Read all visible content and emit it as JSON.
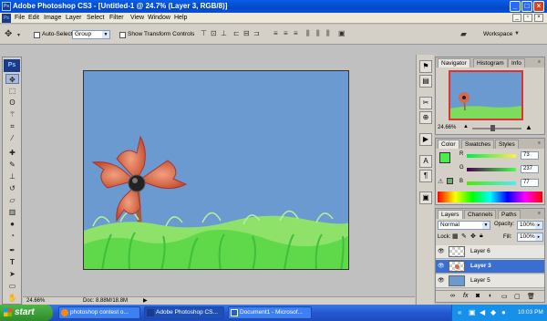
{
  "window": {
    "title": "Adobe Photoshop CS3 - [Untitled-1 @ 24.7% (Layer 3, RGB/8)]",
    "app_badge": "Ps"
  },
  "menu": [
    "File",
    "Edit",
    "Image",
    "Layer",
    "Select",
    "Filter",
    "View",
    "Window",
    "Help"
  ],
  "options": {
    "auto_select_label": "Auto-Select:",
    "auto_select_value": "Group",
    "show_transform_label": "Show Transform Controls",
    "workspace_label": "Workspace"
  },
  "toolbox": {
    "logo": "Ps"
  },
  "status": {
    "zoom": "24.66%",
    "doc": "Doc: 8.88M/18.8M"
  },
  "navigator": {
    "tabs": [
      "Navigator",
      "Histogram",
      "Info"
    ],
    "zoom": "24.66%"
  },
  "color": {
    "tabs": [
      "Color",
      "Swatches",
      "Styles"
    ],
    "r_label": "R",
    "g_label": "G",
    "b_label": "B",
    "r": "73",
    "g": "237",
    "b": "77",
    "fg_color": "#49ed4d"
  },
  "layers": {
    "tabs": [
      "Layers",
      "Channels",
      "Paths"
    ],
    "blend_mode": "Normal",
    "opacity_label": "Opacity:",
    "opacity": "100%",
    "lock_label": "Lock:",
    "fill_label": "Fill:",
    "fill": "100%",
    "rows": [
      {
        "name": "Layer 6"
      },
      {
        "name": "Layer 3"
      },
      {
        "name": "Layer 5"
      }
    ]
  },
  "taskbar": {
    "start": "start",
    "tasks": [
      "photoshop contest o...",
      "Adobe Photoshop CS...",
      "Document1 - Microsof..."
    ],
    "clock": "10:03 PM"
  }
}
